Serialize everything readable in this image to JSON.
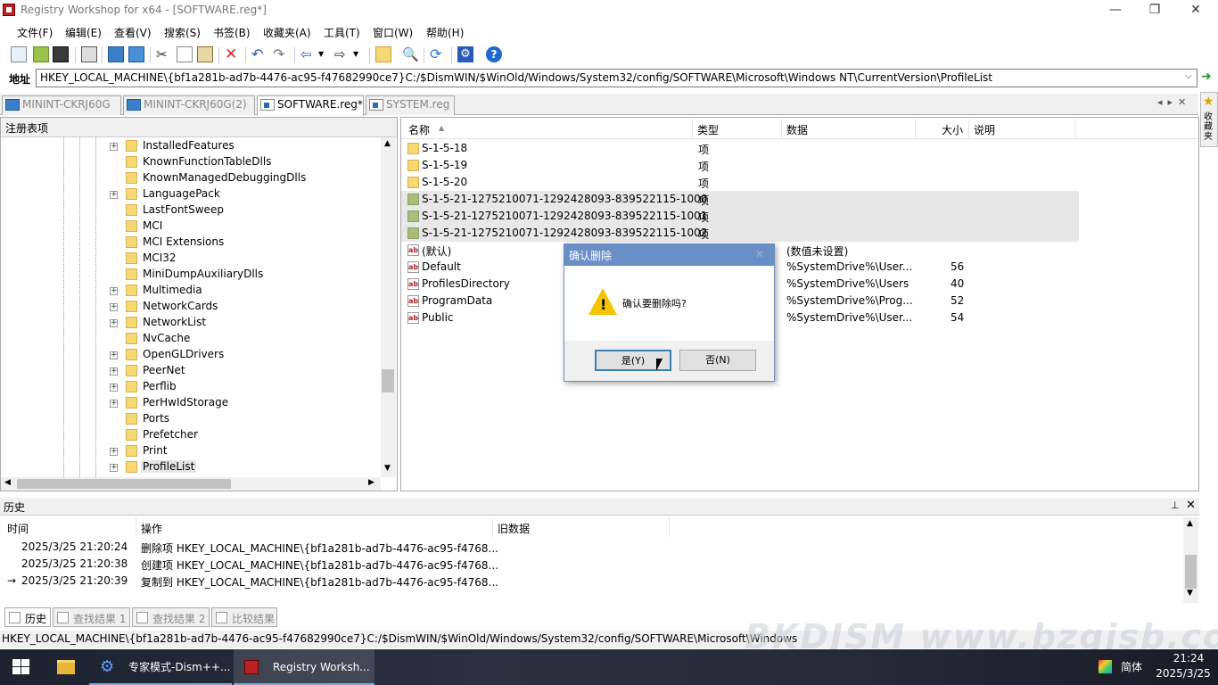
{
  "window": {
    "title": "Registry Workshop for x64 - [SOFTWARE.reg*]",
    "minimize": "—",
    "restore": "❐",
    "close": "✕"
  },
  "menu": [
    "文件(F)",
    "编辑(E)",
    "查看(V)",
    "搜索(S)",
    "书签(B)",
    "收藏夹(A)",
    "工具(T)",
    "窗口(W)",
    "帮助(H)"
  ],
  "address": {
    "label": "地址",
    "value": "HKEY_LOCAL_MACHINE\\{bf1a281b-ad7b-4476-ac95-f47682990ce7}C:/$DismWIN/$WinOld/Windows/System32/config/SOFTWARE\\Microsoft\\Windows NT\\CurrentVersion\\ProfileList"
  },
  "tabs": [
    {
      "label": "MININT-CKRJ60G",
      "icon": "computer-icon",
      "active": false
    },
    {
      "label": "MININT-CKRJ60G(2)",
      "icon": "computer-icon",
      "active": false
    },
    {
      "label": "SOFTWARE.reg*",
      "icon": "hive-file-icon",
      "active": true
    },
    {
      "label": "SYSTEM.reg",
      "icon": "hive-file-icon",
      "active": false
    }
  ],
  "favorites": {
    "label": "收藏夹"
  },
  "tree": {
    "header": "注册表项",
    "items": [
      {
        "label": "InstalledFeatures",
        "expandable": true
      },
      {
        "label": "KnownFunctionTableDlls",
        "expandable": false
      },
      {
        "label": "KnownManagedDebuggingDlls",
        "expandable": false
      },
      {
        "label": "LanguagePack",
        "expandable": true
      },
      {
        "label": "LastFontSweep",
        "expandable": false
      },
      {
        "label": "MCI",
        "expandable": false
      },
      {
        "label": "MCI Extensions",
        "expandable": false
      },
      {
        "label": "MCI32",
        "expandable": false
      },
      {
        "label": "MiniDumpAuxiliaryDlls",
        "expandable": false
      },
      {
        "label": "Multimedia",
        "expandable": true
      },
      {
        "label": "NetworkCards",
        "expandable": true
      },
      {
        "label": "NetworkList",
        "expandable": true
      },
      {
        "label": "NvCache",
        "expandable": false
      },
      {
        "label": "OpenGLDrivers",
        "expandable": true
      },
      {
        "label": "PeerNet",
        "expandable": true
      },
      {
        "label": "Perflib",
        "expandable": true
      },
      {
        "label": "PerHwIdStorage",
        "expandable": true
      },
      {
        "label": "Ports",
        "expandable": false
      },
      {
        "label": "Prefetcher",
        "expandable": false
      },
      {
        "label": "Print",
        "expandable": true
      },
      {
        "label": "ProfileList",
        "expandable": true,
        "selected": true
      }
    ]
  },
  "list": {
    "columns": [
      "名称",
      "类型",
      "数据",
      "大小",
      "说明"
    ],
    "rows": [
      {
        "name": "S-1-5-18",
        "type": "项",
        "data": "",
        "size": "",
        "kind": "folder",
        "selected": false
      },
      {
        "name": "S-1-5-19",
        "type": "项",
        "data": "",
        "size": "",
        "kind": "folder",
        "selected": false
      },
      {
        "name": "S-1-5-20",
        "type": "项",
        "data": "",
        "size": "",
        "kind": "folder",
        "selected": false
      },
      {
        "name": "S-1-5-21-1275210071-1292428093-839522115-1000",
        "type": "项",
        "data": "",
        "size": "",
        "kind": "folder",
        "selected": true
      },
      {
        "name": "S-1-5-21-1275210071-1292428093-839522115-1001",
        "type": "项",
        "data": "",
        "size": "",
        "kind": "folder",
        "selected": true
      },
      {
        "name": "S-1-5-21-1275210071-1292428093-839522115-1002",
        "type": "项",
        "data": "",
        "size": "",
        "kind": "folder",
        "selected": true
      },
      {
        "name": "(默认)",
        "type": "",
        "data": "(数值未设置)",
        "size": "",
        "kind": "string",
        "selected": false
      },
      {
        "name": "Default",
        "type": "",
        "data": "%SystemDrive%\\User...",
        "size": "56",
        "kind": "string",
        "selected": false
      },
      {
        "name": "ProfilesDirectory",
        "type": "",
        "data": "%SystemDrive%\\Users",
        "size": "40",
        "kind": "string",
        "selected": false
      },
      {
        "name": "ProgramData",
        "type": "",
        "data": "%SystemDrive%\\Prog...",
        "size": "52",
        "kind": "string",
        "selected": false
      },
      {
        "name": "Public",
        "type": "",
        "data": "%SystemDrive%\\User...",
        "size": "54",
        "kind": "string",
        "selected": false
      }
    ]
  },
  "dialog": {
    "title": "确认删除",
    "close": "✕",
    "message": "确认要删除吗?",
    "yes": "是(Y)",
    "no": "否(N)"
  },
  "history": {
    "title": "历史",
    "pin": "📌",
    "close": "✕",
    "columns": [
      "时间",
      "操作",
      "旧数据"
    ],
    "rows": [
      {
        "marker": "",
        "time": "2025/3/25 21:20:24",
        "op": "删除项 HKEY_LOCAL_MACHINE\\{bf1a281b-ad7b-4476-ac95-f4768...",
        "old": ""
      },
      {
        "marker": "",
        "time": "2025/3/25 21:20:38",
        "op": "创建项 HKEY_LOCAL_MACHINE\\{bf1a281b-ad7b-4476-ac95-f4768...",
        "old": ""
      },
      {
        "marker": "→",
        "time": "2025/3/25 21:20:39",
        "op": "复制到 HKEY_LOCAL_MACHINE\\{bf1a281b-ad7b-4476-ac95-f4768...",
        "old": ""
      }
    ]
  },
  "bottom_tabs": [
    {
      "label": "历史",
      "active": true
    },
    {
      "label": "查找结果 1",
      "active": false
    },
    {
      "label": "查找结果 2",
      "active": false
    },
    {
      "label": "比较结果",
      "active": false
    }
  ],
  "status": {
    "path": "HKEY_LOCAL_MACHINE\\{bf1a281b-ad7b-4476-ac95-f47682990ce7}C:/$DismWIN/$WinOld/Windows/System32/config/SOFTWARE\\Microsoft\\Windows"
  },
  "watermark": "BKDJSM www.bzgjsb.com",
  "taskbar": {
    "tasks": [
      {
        "label": "专家模式-Dism++...",
        "icon": "dism-gear-icon"
      },
      {
        "label": "Registry Worksh...",
        "icon": "registry-workshop-icon"
      }
    ],
    "ime": "简体",
    "time": "21:24",
    "date": "2025/3/25"
  },
  "colors": {
    "dialog_title": "#6a8fc7",
    "folder": "#f8d775",
    "selected_folder": "#a9bc7a",
    "warning": "#f5c400"
  }
}
